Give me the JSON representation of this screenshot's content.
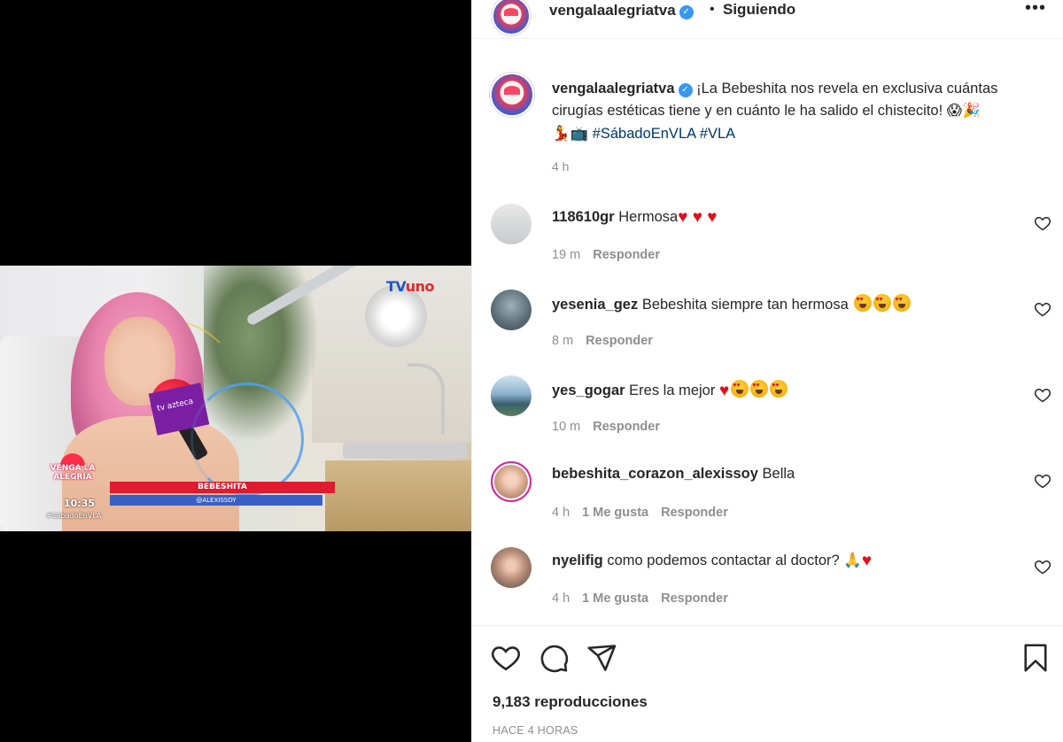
{
  "header": {
    "username": "vengalaalegriatva",
    "verified_mark": "✓",
    "separator": "•",
    "follow_status": "Siguiendo",
    "more_label": "•••"
  },
  "video": {
    "channel_logo_main": "TV",
    "channel_logo_uno": "uno",
    "show_logo": "VENGA LA ALEGRÍA",
    "clock": "10:35",
    "hashtag_overlay": "#SábadoEnVLA",
    "lower_third_name": "BEBESHITA",
    "lower_third_handle": "@ALEXISSOY",
    "mic_flag": "tv azteca"
  },
  "caption": {
    "username": "vengalaalegriatva",
    "text": " ¡La Bebeshita nos revela en exclusiva cuántas cirugías estéticas tiene y en cuánto le ha salido el chistecito! 😱🎉",
    "line2_emoji": "💃📺 ",
    "hashtag1": "#SábadoEnVLA",
    "hashtag2": "#VLA",
    "time": "4 h"
  },
  "comments": [
    {
      "user": "118610gr",
      "text": "Hermosa",
      "hearts": "♥ ♥ ♥",
      "time": "19 m",
      "likes": "",
      "reply": "Responder"
    },
    {
      "user": "yesenia_gez",
      "text": "Bebeshita siempre tan hermosa",
      "faces": 3,
      "time": "8 m",
      "likes": "",
      "reply": "Responder"
    },
    {
      "user": "yes_gogar",
      "text": "Eres la mejor",
      "hearts": "♥",
      "faces": 3,
      "time": "10 m",
      "likes": "",
      "reply": "Responder"
    },
    {
      "user": "bebeshita_corazon_alexissoy",
      "text": "Bella",
      "time": "4 h",
      "likes": "1 Me gusta",
      "reply": "Responder"
    },
    {
      "user": "nyelifig",
      "text": "como podemos contactar al doctor?",
      "emoji": "🙏",
      "hearts": "♥",
      "time": "4 h",
      "likes": "1 Me gusta",
      "reply": "Responder"
    }
  ],
  "footer": {
    "views": "9,183 reproducciones",
    "posted": "HACE 4 HORAS"
  },
  "icons": {
    "like": "heart-outline-icon",
    "comment": "comment-bubble-icon",
    "share": "paper-plane-icon",
    "save": "bookmark-icon",
    "comment_like": "small-heart-outline-icon"
  },
  "colors": {
    "text": "#262626",
    "secondary": "#8e8e8e",
    "hashtag": "#00376b",
    "verified": "#3897f0",
    "heart": "#e0111f"
  }
}
